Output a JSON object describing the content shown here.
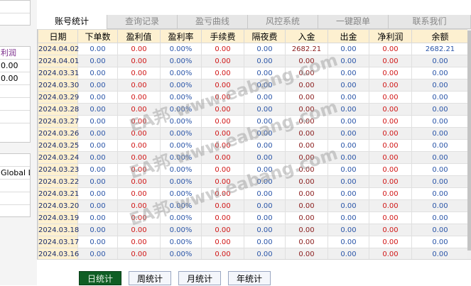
{
  "left_panel": {
    "box1": [
      "",
      ""
    ],
    "box2": [
      "利润",
      "0.00",
      "0.00",
      "",
      "",
      "",
      ""
    ],
    "box3": [
      "",
      "Global Lir",
      "",
      "",
      ""
    ]
  },
  "tabs": [
    {
      "label": "账号统计",
      "active": true
    },
    {
      "label": "查询记录",
      "active": false
    },
    {
      "label": "盈亏曲线",
      "active": false
    },
    {
      "label": "风控系统",
      "active": false
    },
    {
      "label": "一键跟单",
      "active": false
    },
    {
      "label": "联系我们",
      "active": false
    }
  ],
  "table": {
    "headers": [
      "日期",
      "下单数",
      "盈利值",
      "盈利率",
      "手续费",
      "隔夜费",
      "入金",
      "出金",
      "净利润",
      "余额"
    ],
    "rows": [
      [
        "2024.04.02",
        "0.00",
        "0.00",
        "0.00%",
        "0.00",
        "0.00",
        "2682.21",
        "0.00",
        "0.00",
        "2682.21"
      ],
      [
        "2024.04.01",
        "0.00",
        "0.00",
        "0.00%",
        "0.00",
        "0.00",
        "0.00",
        "0.00",
        "0.00",
        "0.00"
      ],
      [
        "2024.03.31",
        "0.00",
        "0.00",
        "0.00%",
        "0.00",
        "0.00",
        "0.00",
        "0.00",
        "0.00",
        "0.00"
      ],
      [
        "2024.03.30",
        "0.00",
        "0.00",
        "0.00%",
        "0.00",
        "0.00",
        "0.00",
        "0.00",
        "0.00",
        "0.00"
      ],
      [
        "2024.03.29",
        "0.00",
        "0.00",
        "0.00%",
        "0.00",
        "0.00",
        "0.00",
        "0.00",
        "0.00",
        "0.00"
      ],
      [
        "2024.03.28",
        "0.00",
        "0.00",
        "0.00%",
        "0.00",
        "0.00",
        "0.00",
        "0.00",
        "0.00",
        "0.00"
      ],
      [
        "2024.03.27",
        "0.00",
        "0.00",
        "0.00%",
        "0.00",
        "0.00",
        "0.00",
        "0.00",
        "0.00",
        "0.00"
      ],
      [
        "2024.03.26",
        "0.00",
        "0.00",
        "0.00%",
        "0.00",
        "0.00",
        "0.00",
        "0.00",
        "0.00",
        "0.00"
      ],
      [
        "2024.03.25",
        "0.00",
        "0.00",
        "0.00%",
        "0.00",
        "0.00",
        "0.00",
        "0.00",
        "0.00",
        "0.00"
      ],
      [
        "2024.03.24",
        "0.00",
        "0.00",
        "0.00%",
        "0.00",
        "0.00",
        "0.00",
        "0.00",
        "0.00",
        "0.00"
      ],
      [
        "2024.03.23",
        "0.00",
        "0.00",
        "0.00%",
        "0.00",
        "0.00",
        "0.00",
        "0.00",
        "0.00",
        "0.00"
      ],
      [
        "2024.03.22",
        "0.00",
        "0.00",
        "0.00%",
        "0.00",
        "0.00",
        "0.00",
        "0.00",
        "0.00",
        "0.00"
      ],
      [
        "2024.03.21",
        "0.00",
        "0.00",
        "0.00%",
        "0.00",
        "0.00",
        "0.00",
        "0.00",
        "0.00",
        "0.00"
      ],
      [
        "2024.03.20",
        "0.00",
        "0.00",
        "0.00%",
        "0.00",
        "0.00",
        "0.00",
        "0.00",
        "0.00",
        "0.00"
      ],
      [
        "2024.03.19",
        "0.00",
        "0.00",
        "0.00%",
        "0.00",
        "0.00",
        "0.00",
        "0.00",
        "0.00",
        "0.00"
      ],
      [
        "2024.03.18",
        "0.00",
        "0.00",
        "0.00%",
        "0.00",
        "0.00",
        "0.00",
        "0.00",
        "0.00",
        "0.00"
      ],
      [
        "2024.03.17",
        "0.00",
        "0.00",
        "0.00%",
        "0.00",
        "0.00",
        "0.00",
        "0.00",
        "0.00",
        "0.00"
      ],
      [
        "2024.03.16",
        "0.00",
        "0.00",
        "0.00%",
        "0.00",
        "0.00",
        "0.00",
        "0.00",
        "0.00",
        "0.00"
      ]
    ],
    "column_colors": [
      "date",
      "blue",
      "red",
      "blue",
      "red",
      "blue",
      "dred",
      "blue",
      "red",
      "blue"
    ]
  },
  "buttons": [
    {
      "label": "日统计",
      "active": true
    },
    {
      "label": "周统计",
      "active": false
    },
    {
      "label": "月统计",
      "active": false
    },
    {
      "label": "年统计",
      "active": false
    }
  ],
  "watermark": "EA邦 www.eabang.com",
  "colors": {
    "header_bg": "#fdf0d0",
    "active_button": "#0f5e24",
    "value_blue": "#2a55a8",
    "value_red": "#d01616"
  }
}
